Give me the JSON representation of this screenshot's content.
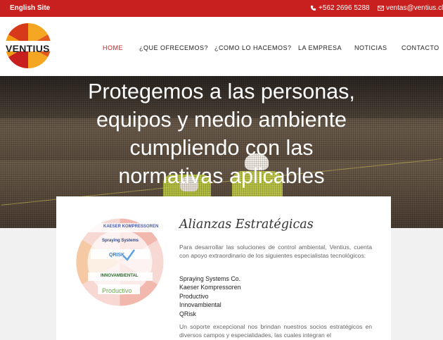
{
  "topbar": {
    "english_site": "English Site",
    "phone": "+562 2696 5288",
    "email": "ventas@ventius.cl"
  },
  "logo": {
    "text": "VENTIUS"
  },
  "nav": {
    "items": [
      "HOME",
      "¿QUE OFRECEMOS?",
      "¿COMO LO HACEMOS?",
      "LA EMPRESA",
      "NOTICIAS",
      "CONTACTO"
    ]
  },
  "hero": {
    "title": "Protegemos a las personas, equipos y medio ambiente cumpliendo con las normativas aplicables"
  },
  "section": {
    "title": "Alianzas Estratégicas",
    "intro": "Para desarrollar las soluciones de control ambiental, Ventius, cuenta con apoyo extraordinario de los siguientes especialistas tecnológicos:",
    "partners": [
      "Spraying Systems Co.",
      "Kaeser Kompressoren",
      "Productivo",
      "Innovambiental",
      "QRisk"
    ],
    "outro": "Un soporte excepcional nos brindan nuestros socios estratégicos en diversos campos y especialidades, las cuales integran el",
    "logo_labels": [
      "KAESER KOMPRESSOREN",
      "Spraying Systems",
      "QRISK",
      "INNOVAMBIENTAL",
      "Productivo"
    ]
  },
  "colors": {
    "brand_red": "#c8201e",
    "accent_orange": "#f5a623"
  }
}
